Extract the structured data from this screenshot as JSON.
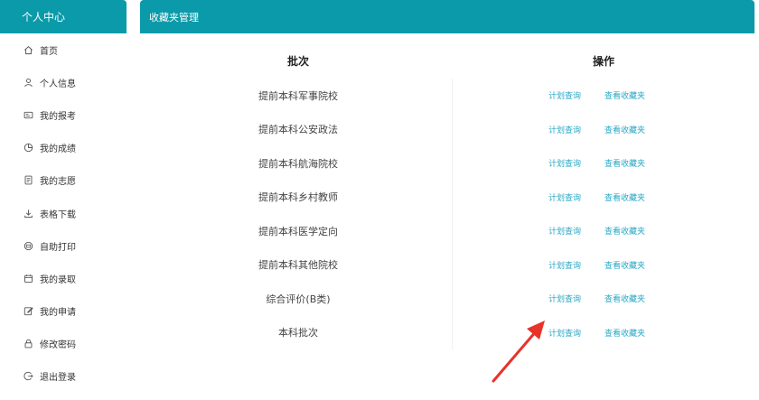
{
  "sidebar": {
    "title": "个人中心",
    "items": [
      {
        "label": "首页",
        "icon": "home-icon"
      },
      {
        "label": "个人信息",
        "icon": "person-icon"
      },
      {
        "label": "我的报考",
        "icon": "id-card-icon"
      },
      {
        "label": "我的成绩",
        "icon": "pie-chart-icon"
      },
      {
        "label": "我的志愿",
        "icon": "document-icon"
      },
      {
        "label": "表格下载",
        "icon": "download-icon"
      },
      {
        "label": "自助打印",
        "icon": "printer-icon"
      },
      {
        "label": "我的录取",
        "icon": "calendar-icon"
      },
      {
        "label": "我的申请",
        "icon": "edit-icon"
      },
      {
        "label": "修改密码",
        "icon": "lock-icon"
      },
      {
        "label": "退出登录",
        "icon": "logout-icon"
      }
    ]
  },
  "main": {
    "title": "收藏夹管理",
    "columns": {
      "batch": "批次",
      "operation": "操作"
    },
    "rows": [
      {
        "batch": "提前本科军事院校",
        "plan": "计划查询",
        "fav": "查看收藏夹"
      },
      {
        "batch": "提前本科公安政法",
        "plan": "计划查询",
        "fav": "查看收藏夹"
      },
      {
        "batch": "提前本科航海院校",
        "plan": "计划查询",
        "fav": "查看收藏夹"
      },
      {
        "batch": "提前本科乡村教师",
        "plan": "计划查询",
        "fav": "查看收藏夹"
      },
      {
        "batch": "提前本科医学定向",
        "plan": "计划查询",
        "fav": "查看收藏夹"
      },
      {
        "batch": "提前本科其他院校",
        "plan": "计划查询",
        "fav": "查看收藏夹"
      },
      {
        "batch": "综合评价(B类)",
        "plan": "计划查询",
        "fav": "查看收藏夹"
      },
      {
        "batch": "本科批次",
        "plan": "计划查询",
        "fav": "查看收藏夹"
      }
    ]
  },
  "colors": {
    "accent": "#0a9aa9",
    "link": "#2aa8c6",
    "annotation": "#e8322a"
  }
}
